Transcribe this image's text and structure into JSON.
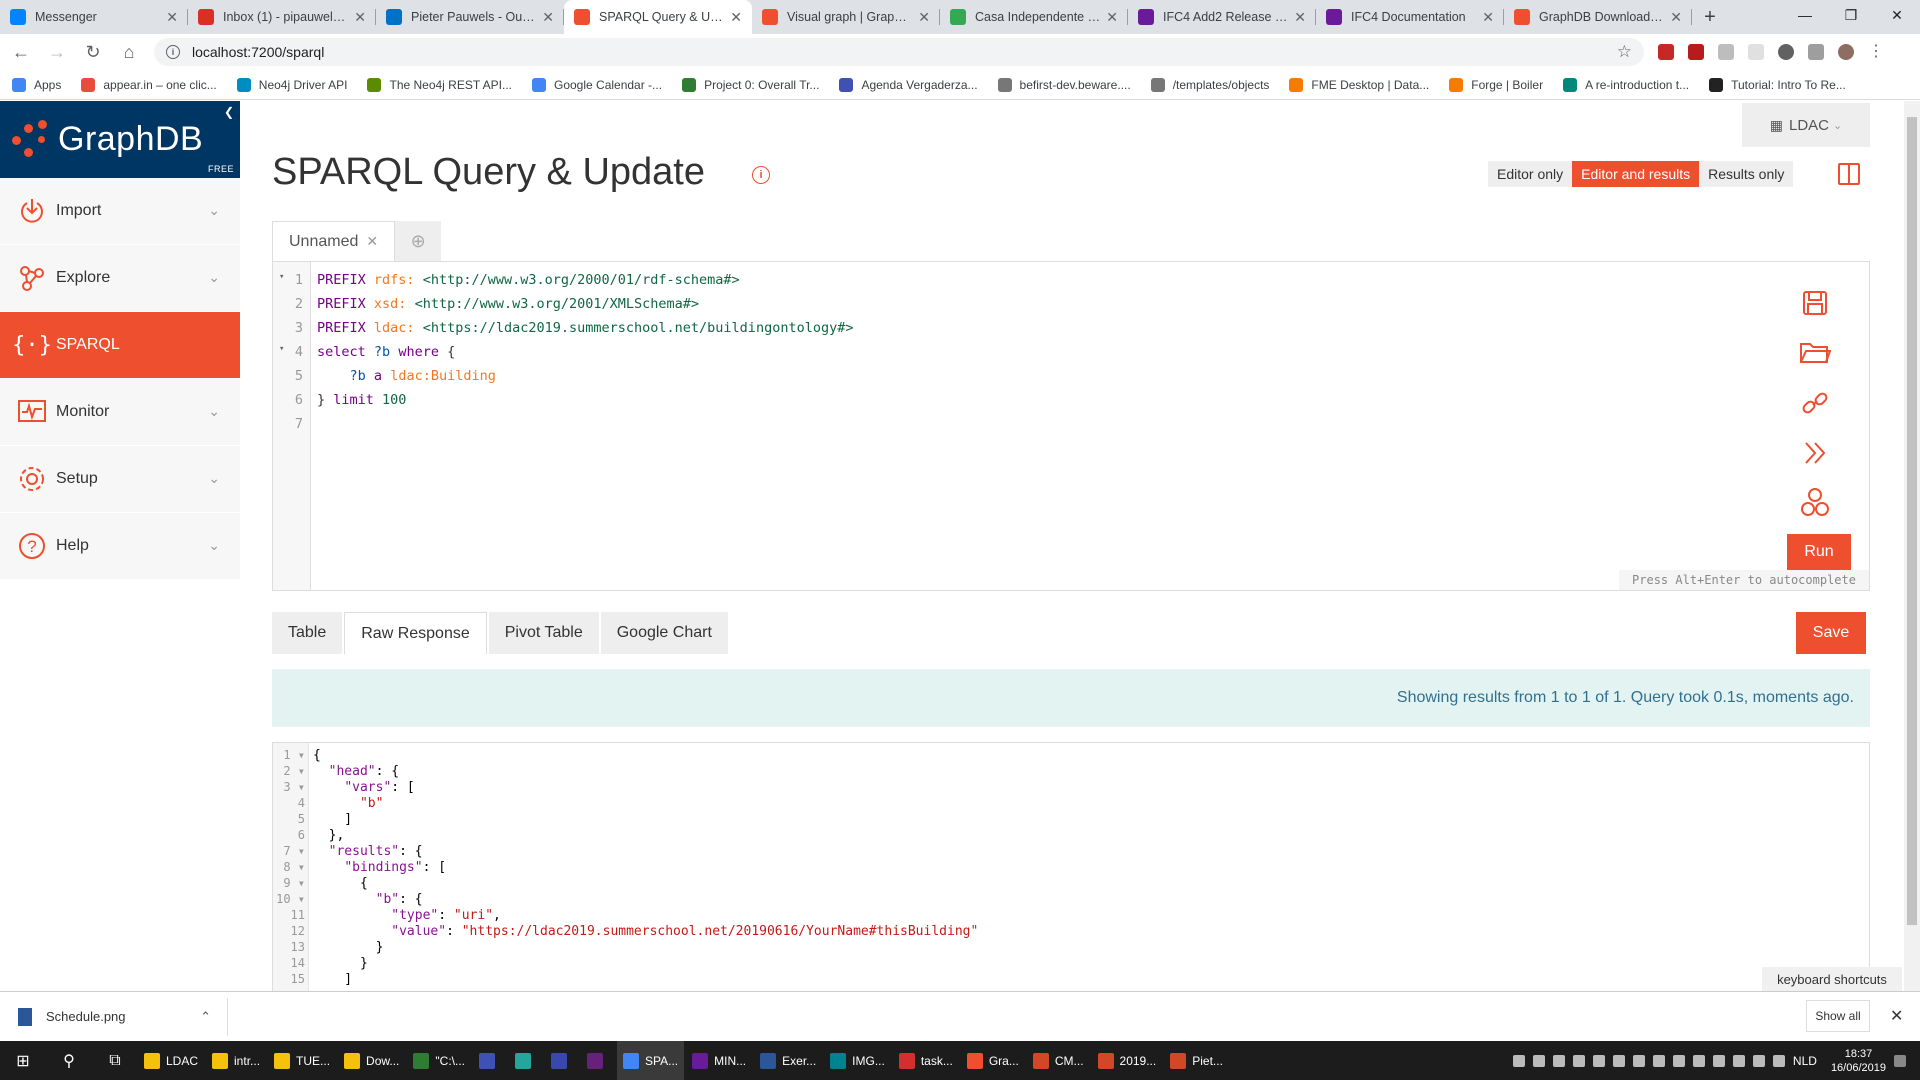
{
  "browser": {
    "tabs": [
      {
        "label": "Messenger",
        "color": "#0084ff",
        "active": false
      },
      {
        "label": "Inbox (1) - pipauwel@g",
        "color": "#d93025",
        "active": false
      },
      {
        "label": "Pieter Pauwels - Outloo",
        "color": "#0072c6",
        "active": false
      },
      {
        "label": "SPARQL Query & Upda",
        "color": "#ed4f2f",
        "active": true
      },
      {
        "label": "Visual graph | GraphDB",
        "color": "#ed4f2f",
        "active": false
      },
      {
        "label": "Casa Independente - G",
        "color": "#34a853",
        "active": false
      },
      {
        "label": "IFC4 Add2 Release — V",
        "color": "#6a1b9a",
        "active": false
      },
      {
        "label": "IFC4 Documentation",
        "color": "#6a1b9a",
        "active": false
      },
      {
        "label": "GraphDB Downloads a",
        "color": "#ed4f2f",
        "active": false
      }
    ],
    "url": "localhost:7200/sparql",
    "bookmarks": [
      {
        "label": "Apps",
        "color": "#4285f4"
      },
      {
        "label": "appear.in – one clic...",
        "color": "#e84c3d"
      },
      {
        "label": "Neo4j Driver API",
        "color": "#008cc1"
      },
      {
        "label": "The Neo4j REST API...",
        "color": "#5b8c00"
      },
      {
        "label": "Google Calendar -...",
        "color": "#4285f4"
      },
      {
        "label": "Project 0: Overall Tr...",
        "color": "#2e7d32"
      },
      {
        "label": "Agenda Vergaderza...",
        "color": "#3f51b5"
      },
      {
        "label": "befirst-dev.beware....",
        "color": "#777777"
      },
      {
        "label": "/templates/objects",
        "color": "#777777"
      },
      {
        "label": "FME Desktop | Data...",
        "color": "#f57c00"
      },
      {
        "label": "Forge | Boiler",
        "color": "#f57c00"
      },
      {
        "label": "A re-introduction t...",
        "color": "#00897b"
      },
      {
        "label": "Tutorial: Intro To Re...",
        "color": "#222222"
      }
    ]
  },
  "app": {
    "brand": "GraphDB",
    "edition": "FREE",
    "nav": [
      {
        "key": "import",
        "label": "Import",
        "active": false
      },
      {
        "key": "explore",
        "label": "Explore",
        "active": false
      },
      {
        "key": "sparql",
        "label": "SPARQL",
        "active": true
      },
      {
        "key": "monitor",
        "label": "Monitor",
        "active": false
      },
      {
        "key": "setup",
        "label": "Setup",
        "active": false
      },
      {
        "key": "help",
        "label": "Help",
        "active": false
      }
    ],
    "repository": "LDAC",
    "page_title": "SPARQL Query & Update",
    "view_modes": [
      "Editor only",
      "Editor and results",
      "Results only"
    ],
    "selected_view_mode": "Editor and results",
    "query_tab": "Unnamed",
    "run_label": "Run",
    "autocomplete_hint": "Press Alt+Enter to autocomplete",
    "result_tabs": [
      "Table",
      "Raw Response",
      "Pivot Table",
      "Google Chart"
    ],
    "selected_result_tab": "Raw Response",
    "save_label": "Save",
    "status": "Showing results from 1 to 1 of 1. Query took 0.1s, moments ago.",
    "keyboard_shortcuts": "keyboard shortcuts",
    "accent": "#ed4f2f"
  },
  "query_lines": [
    "PREFIX rdfs: <http://www.w3.org/2000/01/rdf-schema#>",
    "PREFIX xsd: <http://www.w3.org/2001/XMLSchema#>",
    "PREFIX ldac: <https://ldac2019.summerschool.net/buildingontology#>",
    "select ?b where {",
    "    ?b a ldac:Building",
    "} limit 100",
    ""
  ],
  "response_lines": [
    "{",
    "  \"head\": {",
    "    \"vars\": [",
    "      \"b\"",
    "    ]",
    "  },",
    "  \"results\": {",
    "    \"bindings\": [",
    "      {",
    "        \"b\": {",
    "          \"type\": \"uri\",",
    "          \"value\": \"https://ldac2019.summerschool.net/20190616/YourName#thisBuilding\"",
    "        }",
    "      }",
    "    ]"
  ],
  "downloads": {
    "file": "Schedule.png",
    "show_all": "Show all"
  },
  "taskbar": {
    "apps": [
      "LDAC",
      "intr...",
      "TUE...",
      "Dow...",
      "\"C:\\...",
      "",
      "",
      "",
      "",
      "SPA...",
      "MIN...",
      "Exer...",
      "IMG...",
      "task...",
      "Gra...",
      "CM...",
      "2019...",
      "Piet..."
    ],
    "lang": "NLD",
    "time": "18:37",
    "date": "16/06/2019"
  }
}
